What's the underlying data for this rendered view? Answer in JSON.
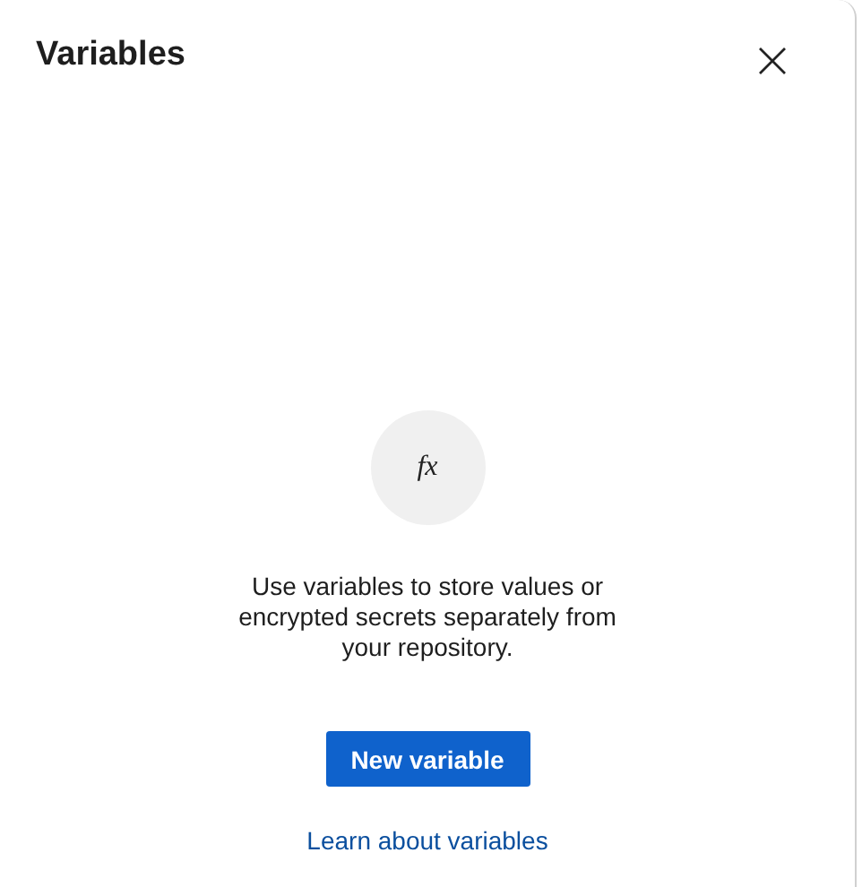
{
  "panel": {
    "title": "Variables"
  },
  "empty_state": {
    "icon_text": "fx",
    "message": "Use variables to store values or encrypted secrets separately from your repository.",
    "button": "New variable",
    "link": "Learn about variables"
  }
}
